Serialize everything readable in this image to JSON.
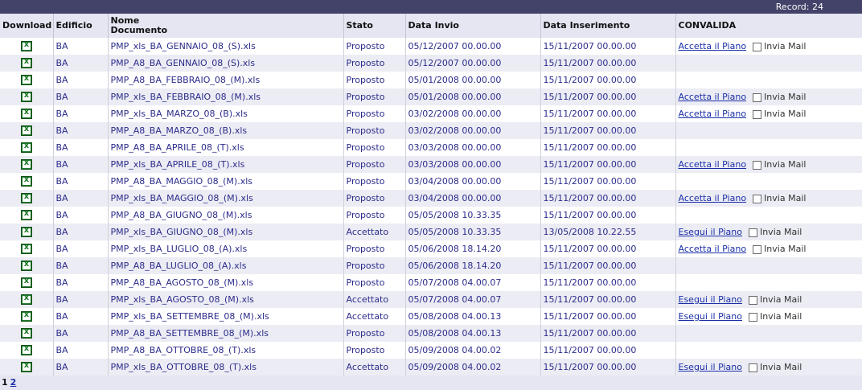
{
  "header": {
    "record_label": "Record: 24"
  },
  "columns": {
    "download": "Download",
    "edificio": "Edificio",
    "nome1": "Nome",
    "nome2": "Documento",
    "stato": "Stato",
    "data_invio": "Data Invio",
    "data_inserimento": "Data Inserimento",
    "convalida": "CONVALIDA"
  },
  "icons": {
    "download": "excel-file-icon"
  },
  "rows": [
    {
      "edificio": "BA",
      "nome": "PMP_xls_BA_GENNAIO_08_(S).xls",
      "stato": "Proposto",
      "invio": "05/12/2007 00.00.00",
      "inserimento": "15/11/2007 00.00.00",
      "azione": "Accetta il Piano",
      "mail": "Invia Mail"
    },
    {
      "edificio": "BA",
      "nome": "PMP_A8_BA_GENNAIO_08_(S).xls",
      "stato": "Proposto",
      "invio": "05/12/2007 00.00.00",
      "inserimento": "15/11/2007 00.00.00",
      "azione": "",
      "mail": ""
    },
    {
      "edificio": "BA",
      "nome": "PMP_A8_BA_FEBBRAIO_08_(M).xls",
      "stato": "Proposto",
      "invio": "05/01/2008 00.00.00",
      "inserimento": "15/11/2007 00.00.00",
      "azione": "",
      "mail": ""
    },
    {
      "edificio": "BA",
      "nome": "PMP_xls_BA_FEBBRAIO_08_(M).xls",
      "stato": "Proposto",
      "invio": "05/01/2008 00.00.00",
      "inserimento": "15/11/2007 00.00.00",
      "azione": "Accetta il Piano",
      "mail": "Invia Mail"
    },
    {
      "edificio": "BA",
      "nome": "PMP_xls_BA_MARZO_08_(B).xls",
      "stato": "Proposto",
      "invio": "03/02/2008 00.00.00",
      "inserimento": "15/11/2007 00.00.00",
      "azione": "Accetta il Piano",
      "mail": "Invia Mail"
    },
    {
      "edificio": "BA",
      "nome": "PMP_A8_BA_MARZO_08_(B).xls",
      "stato": "Proposto",
      "invio": "03/02/2008 00.00.00",
      "inserimento": "15/11/2007 00.00.00",
      "azione": "",
      "mail": ""
    },
    {
      "edificio": "BA",
      "nome": "PMP_A8_BA_APRILE_08_(T).xls",
      "stato": "Proposto",
      "invio": "03/03/2008 00.00.00",
      "inserimento": "15/11/2007 00.00.00",
      "azione": "",
      "mail": ""
    },
    {
      "edificio": "BA",
      "nome": "PMP_xls_BA_APRILE_08_(T).xls",
      "stato": "Proposto",
      "invio": "03/03/2008 00.00.00",
      "inserimento": "15/11/2007 00.00.00",
      "azione": "Accetta il Piano",
      "mail": "Invia Mail"
    },
    {
      "edificio": "BA",
      "nome": "PMP_A8_BA_MAGGIO_08_(M).xls",
      "stato": "Proposto",
      "invio": "03/04/2008 00.00.00",
      "inserimento": "15/11/2007 00.00.00",
      "azione": "",
      "mail": ""
    },
    {
      "edificio": "BA",
      "nome": "PMP_xls_BA_MAGGIO_08_(M).xls",
      "stato": "Proposto",
      "invio": "03/04/2008 00.00.00",
      "inserimento": "15/11/2007 00.00.00",
      "azione": "Accetta il Piano",
      "mail": "Invia Mail"
    },
    {
      "edificio": "BA",
      "nome": "PMP_A8_BA_GIUGNO_08_(M).xls",
      "stato": "Proposto",
      "invio": "05/05/2008 10.33.35",
      "inserimento": "15/11/2007 00.00.00",
      "azione": "",
      "mail": ""
    },
    {
      "edificio": "BA",
      "nome": "PMP_xls_BA_GIUGNO_08_(M).xls",
      "stato": "Accettato",
      "invio": "05/05/2008 10.33.35",
      "inserimento": "13/05/2008 10.22.55",
      "azione": "Esegui il Piano",
      "mail": "Invia Mail"
    },
    {
      "edificio": "BA",
      "nome": "PMP_xls_BA_LUGLIO_08_(A).xls",
      "stato": "Proposto",
      "invio": "05/06/2008 18.14.20",
      "inserimento": "15/11/2007 00.00.00",
      "azione": "Accetta il Piano",
      "mail": "Invia Mail"
    },
    {
      "edificio": "BA",
      "nome": "PMP_A8_BA_LUGLIO_08_(A).xls",
      "stato": "Proposto",
      "invio": "05/06/2008 18.14.20",
      "inserimento": "15/11/2007 00.00.00",
      "azione": "",
      "mail": ""
    },
    {
      "edificio": "BA",
      "nome": "PMP_A8_BA_AGOSTO_08_(M).xls",
      "stato": "Proposto",
      "invio": "05/07/2008 04.00.07",
      "inserimento": "15/11/2007 00.00.00",
      "azione": "",
      "mail": ""
    },
    {
      "edificio": "BA",
      "nome": "PMP_xls_BA_AGOSTO_08_(M).xls",
      "stato": "Accettato",
      "invio": "05/07/2008 04.00.07",
      "inserimento": "15/11/2007 00.00.00",
      "azione": "Esegui il Piano",
      "mail": "Invia Mail"
    },
    {
      "edificio": "BA",
      "nome": "PMP_xls_BA_SETTEMBRE_08_(M).xls",
      "stato": "Accettato",
      "invio": "05/08/2008 04.00.13",
      "inserimento": "15/11/2007 00.00.00",
      "azione": "Esegui il Piano",
      "mail": "Invia Mail"
    },
    {
      "edificio": "BA",
      "nome": "PMP_A8_BA_SETTEMBRE_08_(M).xls",
      "stato": "Proposto",
      "invio": "05/08/2008 04.00.13",
      "inserimento": "15/11/2007 00.00.00",
      "azione": "",
      "mail": ""
    },
    {
      "edificio": "BA",
      "nome": "PMP_A8_BA_OTTOBRE_08_(T).xls",
      "stato": "Proposto",
      "invio": "05/09/2008 04.00.02",
      "inserimento": "15/11/2007 00.00.00",
      "azione": "",
      "mail": ""
    },
    {
      "edificio": "BA",
      "nome": "PMP_xls_BA_OTTOBRE_08_(T).xls",
      "stato": "Accettato",
      "invio": "05/09/2008 04.00.02",
      "inserimento": "15/11/2007 00.00.00",
      "azione": "Esegui il Piano",
      "mail": "Invia Mail"
    }
  ],
  "pager": {
    "current": "1",
    "next": "2"
  }
}
